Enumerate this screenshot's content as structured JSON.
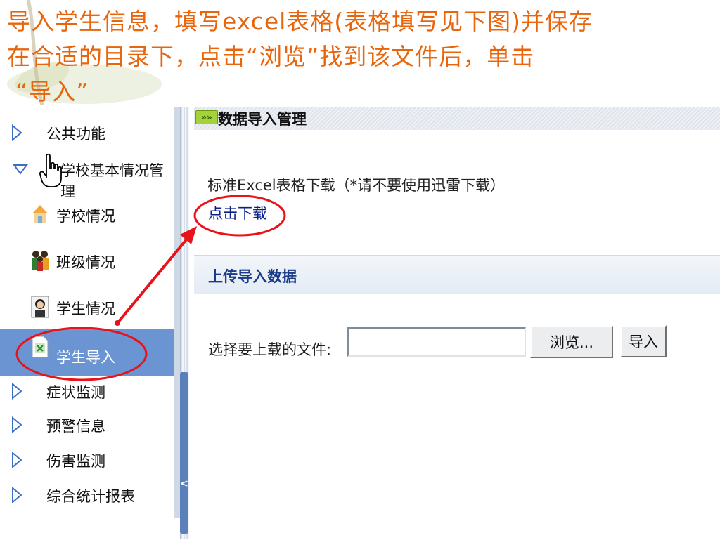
{
  "instruction": {
    "line1": "导入学生信息，填写excel表格(表格填写见下图)并保存",
    "line2": "在合适的目录下，点击“浏览”找到该文件后，单击",
    "line3": "“导入”"
  },
  "sidebar": {
    "items": [
      {
        "label": "公共功能",
        "icon": "triangle-right-icon",
        "expanded": false
      },
      {
        "label": "学校基本情况管理",
        "icon": "triangle-down-icon",
        "expanded": true
      },
      {
        "label": "学校情况",
        "icon": "school-icon"
      },
      {
        "label": "班级情况",
        "icon": "class-group-icon"
      },
      {
        "label": "学生情况",
        "icon": "student-icon"
      },
      {
        "label": "学生导入",
        "icon": "import-file-icon",
        "active": true
      },
      {
        "label": "症状监测",
        "icon": "triangle-right-icon",
        "expanded": false
      },
      {
        "label": "预警信息",
        "icon": "triangle-right-icon",
        "expanded": false
      },
      {
        "label": "伤害监测",
        "icon": "triangle-right-icon",
        "expanded": false
      },
      {
        "label": "综合统计报表",
        "icon": "triangle-right-icon",
        "expanded": false
      }
    ]
  },
  "main": {
    "header_title": "数据导入管理",
    "download_label": "标准Excel表格下载（*请不要使用迅雷下载）",
    "download_link": "点击下载",
    "upload_title": "上传导入数据",
    "file_label": "选择要上载的文件:",
    "file_value": "",
    "browse_button": "浏览...",
    "import_button": "导入"
  },
  "colors": {
    "instruction_text": "#e8650c",
    "active_item_bg": "#6b95d2",
    "annotation_red": "#e8121b",
    "link_text": "#0a1f8c"
  }
}
